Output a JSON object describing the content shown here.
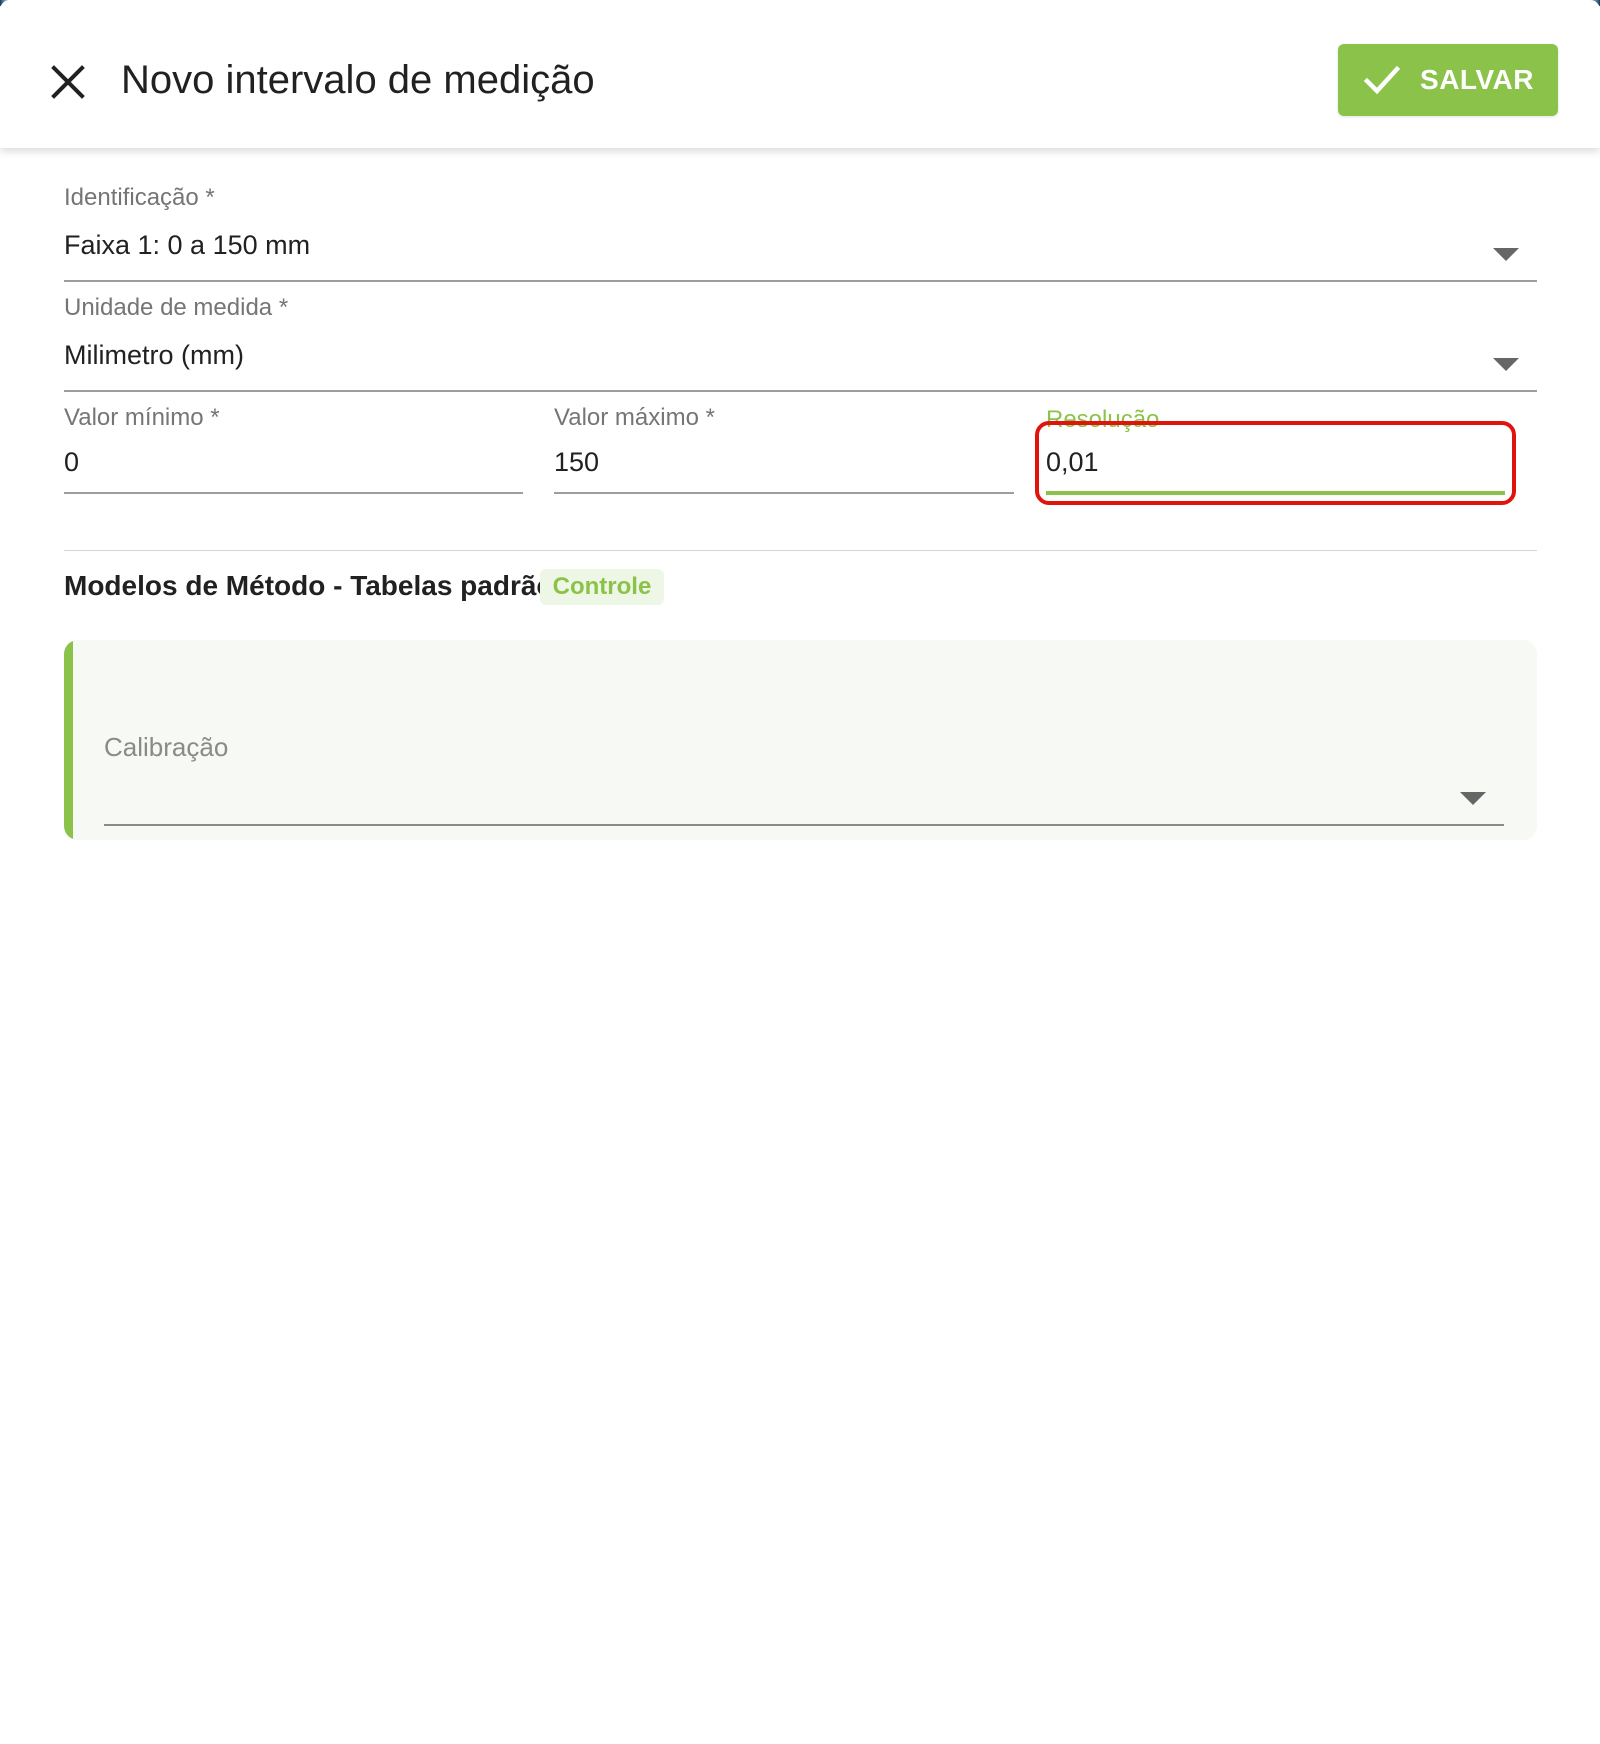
{
  "header": {
    "title": "Novo intervalo de medição",
    "close_icon": "close-icon",
    "save_button": {
      "label": "SALVAR",
      "icon": "check-icon"
    }
  },
  "form": {
    "identificacao": {
      "label": "Identificação *",
      "value": "Faixa 1: 0 a 150 mm"
    },
    "unidade": {
      "label": "Unidade de medida *",
      "value": "Milimetro (mm)"
    },
    "valor_minimo": {
      "label": "Valor mínimo *",
      "value": "0"
    },
    "valor_maximo": {
      "label": "Valor máximo *",
      "value": "150"
    },
    "resolucao": {
      "label": "Resolução",
      "value": "0,01"
    }
  },
  "section": {
    "title": "Modelos de Método - Tabelas padrão",
    "chip": "Controle",
    "calibracao": {
      "placeholder": "Calibração"
    }
  },
  "colors": {
    "accent": "#8bc34a",
    "highlight": "#e0140d",
    "text": "#212121",
    "label": "#757575"
  }
}
